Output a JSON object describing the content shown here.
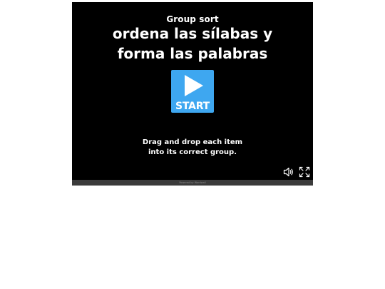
{
  "activity": {
    "type_label": "Group sort",
    "title_lines": [
      "ordena las sílabas y",
      "forma las palabras"
    ],
    "start_label": "START",
    "instructions_lines": [
      "Drag and drop each item",
      "into its correct group."
    ]
  },
  "controls": {
    "sound_icon": "speaker-icon",
    "fullscreen_icon": "fullscreen-icon"
  },
  "footer": {
    "powered_by": "Powered by Wordwall"
  },
  "colors": {
    "stage_bg": "#000000",
    "start_button": "#3ea7f0",
    "footer_bg": "#3b3b3b"
  }
}
